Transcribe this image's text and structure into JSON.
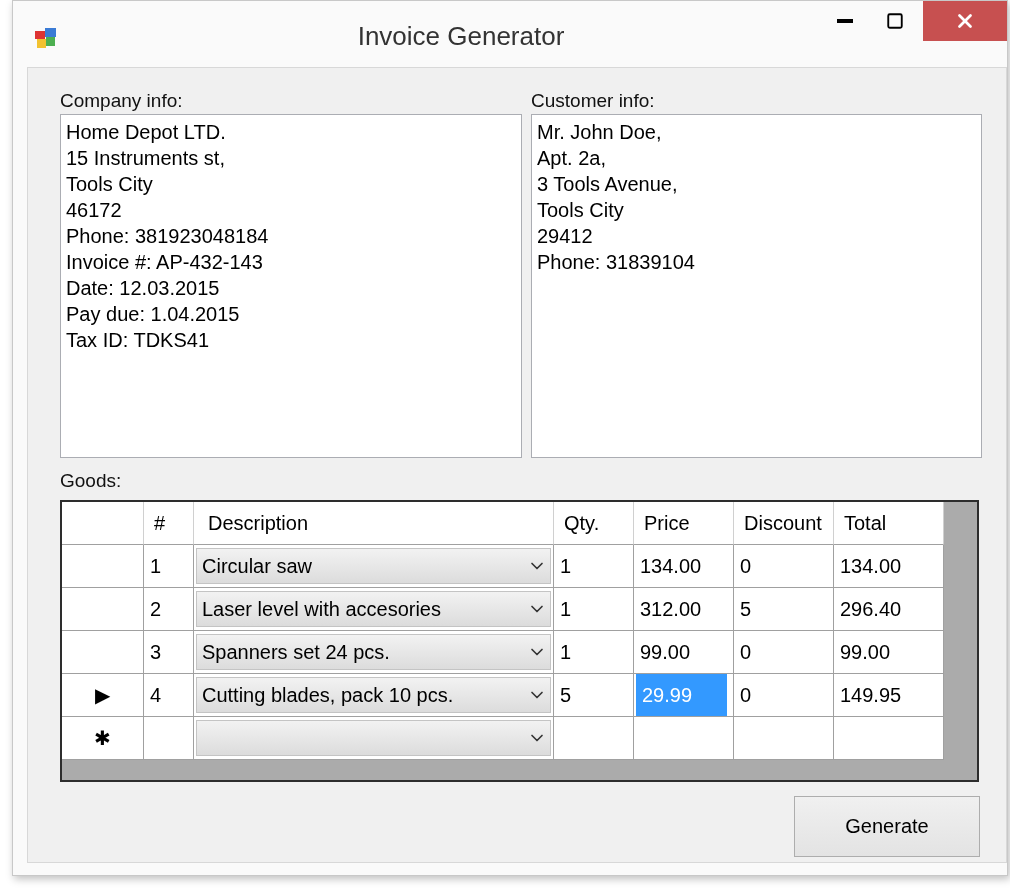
{
  "window": {
    "title": "Invoice Generator"
  },
  "company_info": {
    "label": "Company info:",
    "lines": [
      "Home Depot LTD.",
      "15 Instruments st,",
      "Tools City",
      "46172",
      "Phone: 381923048184",
      "Invoice #: AP-432-143",
      "Date: 12.03.2015",
      "Pay due: 1.04.2015",
      "Tax ID: TDKS41"
    ]
  },
  "customer_info": {
    "label": "Customer info:",
    "lines": [
      "Mr. John Doe,",
      "Apt. 2a,",
      "3 Tools Avenue,",
      "Tools City",
      "29412",
      "Phone: 31839104"
    ]
  },
  "goods": {
    "label": "Goods:",
    "columns": [
      {
        "label": "#",
        "kind": "text"
      },
      {
        "label": "Description",
        "kind": "combo"
      },
      {
        "label": "Qty.",
        "kind": "text"
      },
      {
        "label": "Price",
        "kind": "text"
      },
      {
        "label": "Discount",
        "kind": "text"
      },
      {
        "label": "Total",
        "kind": "text"
      }
    ],
    "rows": [
      {
        "row_header": "",
        "cells": [
          {
            "text": "1",
            "selected": false
          },
          {
            "text": "Circular saw",
            "selected": false
          },
          {
            "text": "1",
            "selected": false
          },
          {
            "text": "134.00",
            "selected": false
          },
          {
            "text": "0",
            "selected": false
          },
          {
            "text": "134.00",
            "selected": false
          }
        ]
      },
      {
        "row_header": "",
        "cells": [
          {
            "text": "2",
            "selected": false
          },
          {
            "text": "Laser level with accesories",
            "selected": false
          },
          {
            "text": "1",
            "selected": false
          },
          {
            "text": "312.00",
            "selected": false
          },
          {
            "text": "5",
            "selected": false
          },
          {
            "text": "296.40",
            "selected": false
          }
        ]
      },
      {
        "row_header": "",
        "cells": [
          {
            "text": "3",
            "selected": false
          },
          {
            "text": "Spanners set 24 pcs.",
            "selected": false
          },
          {
            "text": "1",
            "selected": false
          },
          {
            "text": "99.00",
            "selected": false
          },
          {
            "text": "0",
            "selected": false
          },
          {
            "text": "99.00",
            "selected": false
          }
        ]
      },
      {
        "row_header": "▶",
        "cells": [
          {
            "text": "4",
            "selected": false
          },
          {
            "text": "Cutting blades, pack 10 pcs.",
            "selected": false
          },
          {
            "text": "5",
            "selected": false
          },
          {
            "text": "29.99",
            "selected": true
          },
          {
            "text": "0",
            "selected": false
          },
          {
            "text": "149.95",
            "selected": false
          }
        ]
      },
      {
        "row_header": "✱",
        "cells": [
          {
            "text": "",
            "selected": false
          },
          {
            "text": "",
            "selected": false
          },
          {
            "text": "",
            "selected": false
          },
          {
            "text": "",
            "selected": false
          },
          {
            "text": "",
            "selected": false
          },
          {
            "text": "",
            "selected": false
          }
        ]
      }
    ]
  },
  "buttons": [
    {
      "label": "Generate"
    }
  ]
}
